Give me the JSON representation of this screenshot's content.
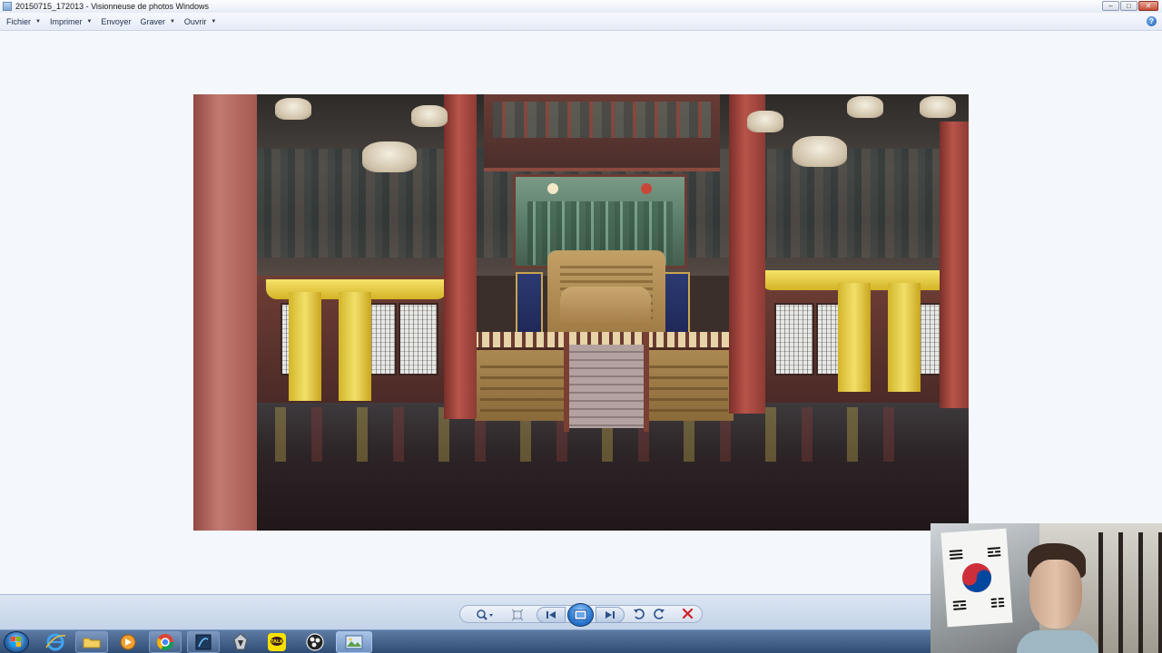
{
  "window": {
    "title": "20150715_172013 - Visionneuse de photos Windows",
    "controls": [
      "–",
      "□",
      "✕"
    ]
  },
  "menu": {
    "items": [
      {
        "label": "Fichier",
        "has_dropdown": true
      },
      {
        "label": "Imprimer",
        "has_dropdown": true
      },
      {
        "label": "Envoyer",
        "has_dropdown": false
      },
      {
        "label": "Graver",
        "has_dropdown": true
      },
      {
        "label": "Ouvrir",
        "has_dropdown": true
      }
    ],
    "help_icon": "help-icon"
  },
  "viewer": {
    "photo_subject": "palace-throne-hall-photo"
  },
  "colors": {
    "viewer_bg": "#f4f7fc",
    "toolbar_bg": "#cbd8ea",
    "taskbar_bg": "#3d5a82",
    "delete_red": "#d0202a"
  }
}
